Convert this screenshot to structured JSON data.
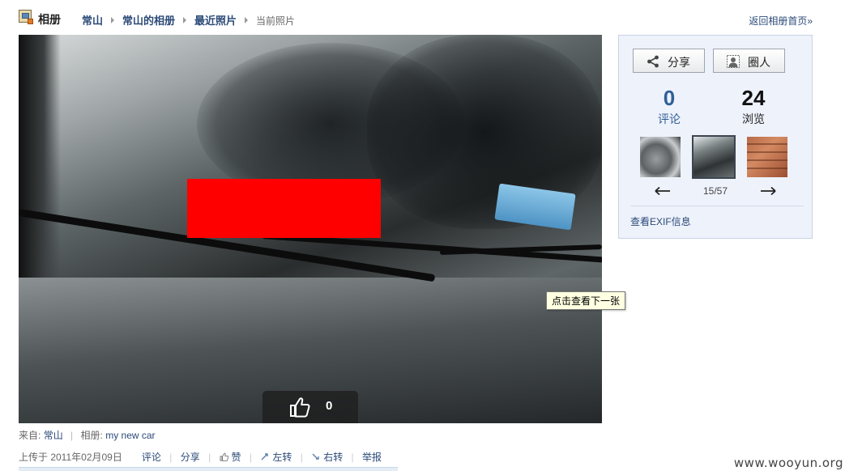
{
  "header": {
    "title": "相册",
    "breadcrumbs": [
      "常山",
      "常山的相册",
      "最近照片"
    ],
    "current": "当前照片",
    "back_link": "返回相册首页»"
  },
  "photo": {
    "like_count": "0",
    "tooltip": "点击查看下一张"
  },
  "meta": {
    "from_label": "来自:",
    "from_user": "常山",
    "album_label": "相册:",
    "album_name": "my new car",
    "uploaded": "上传于 2011年02月09日",
    "actions": {
      "comment": "评论",
      "share": "分享",
      "like": "赞",
      "rotate_left": "左转",
      "rotate_right": "右转",
      "report": "举报"
    }
  },
  "sidebar": {
    "share_button": "分享",
    "circle_button": "圈人",
    "comments_count": "0",
    "comments_label": "评论",
    "views_count": "24",
    "views_label": "浏览",
    "counter": "15/57",
    "exif_link": "查看EXIF信息"
  },
  "watermark": "www.wooyun.org",
  "colors": {
    "link": "#2b4a78",
    "sidebar_bg": "#eef2fb",
    "redaction": "#ff0000"
  },
  "icons": {
    "header": "album-icon",
    "like": "thumbs-up-icon",
    "share": "share-icon",
    "circle": "person-icon",
    "prev": "arrow-left-icon",
    "next": "arrow-right-icon"
  }
}
